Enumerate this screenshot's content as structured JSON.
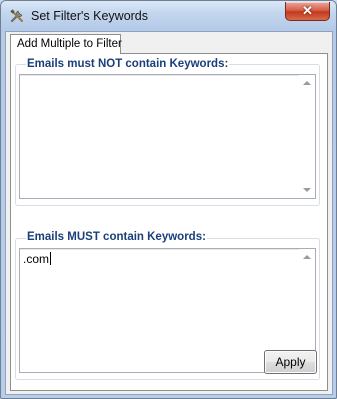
{
  "window": {
    "title": "Set Filter's Keywords",
    "close_glyph": "✕",
    "title_icon": "tools-icon"
  },
  "tabs": [
    {
      "label": "Add Multiple to Filter",
      "selected": true
    }
  ],
  "not_contain": {
    "label": "Emails must NOT contain Keywords:",
    "value": ""
  },
  "must_contain": {
    "label": "Emails MUST contain Keywords:",
    "value": ".com"
  },
  "buttons": {
    "apply": "Apply"
  },
  "colors": {
    "group_label": "#1a3f7a",
    "close_button": "#c3391f"
  }
}
